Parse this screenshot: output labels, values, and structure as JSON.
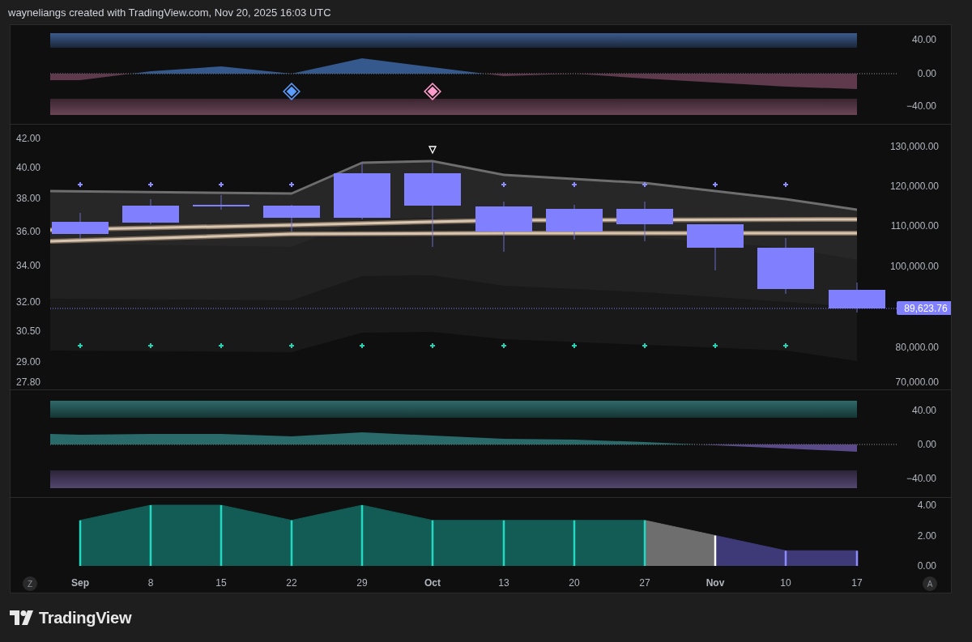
{
  "header": {
    "credit": "wayneliangs created with TradingView.com, Nov 20, 2025 16:03 UTC"
  },
  "oscillator_top": {
    "ticks": [
      "40.00",
      "0.00",
      "−40.00"
    ]
  },
  "price_pane": {
    "left_ticks": [
      "42.00",
      "40.00",
      "38.00",
      "36.00",
      "34.00",
      "32.00",
      "30.50",
      "29.00",
      "27.80"
    ],
    "right_ticks": [
      "130,000.00",
      "120,000.00",
      "110,000.00",
      "100,000.00",
      "80,000.00",
      "70,000.00"
    ],
    "last_price": "89,623.76"
  },
  "oscillator_bottom": {
    "ticks": [
      "40.00",
      "0.00",
      "−40.00"
    ]
  },
  "score_pane": {
    "chart_data": {
      "type": "area",
      "categories": [
        "Sep",
        "8",
        "15",
        "22",
        "29",
        "Oct",
        "13",
        "20",
        "27",
        "Nov",
        "10",
        "17"
      ],
      "series": [
        {
          "color": "#135c55",
          "values": [
            3,
            4,
            4,
            3,
            4,
            3,
            3,
            3,
            3,
            null,
            null,
            null
          ]
        },
        {
          "color": "#6e6e6e",
          "values": [
            null,
            null,
            null,
            null,
            null,
            null,
            null,
            null,
            3,
            2,
            null,
            null
          ]
        },
        {
          "color": "#3e3a78",
          "values": [
            null,
            null,
            null,
            null,
            null,
            null,
            null,
            null,
            null,
            2,
            1,
            1
          ]
        }
      ],
      "grid": true,
      "ylim": [
        0,
        4
      ],
      "yticks": [
        {
          "value": 4,
          "label": "4.00"
        },
        {
          "value": 2,
          "label": "2.00"
        },
        {
          "value": 0,
          "label": "0.00"
        }
      ]
    }
  },
  "time_axis": [
    {
      "major": true
    },
    {
      "major": false
    },
    {
      "major": false
    },
    {
      "major": false
    },
    {
      "major": false
    },
    {
      "major": true
    },
    {
      "major": false
    },
    {
      "major": false
    },
    {
      "major": false
    },
    {
      "major": true
    },
    {
      "major": false
    },
    {
      "major": false
    }
  ],
  "axis_buttons": {
    "left": "Z",
    "right": "A"
  },
  "footer": {
    "brand": "TradingView"
  }
}
